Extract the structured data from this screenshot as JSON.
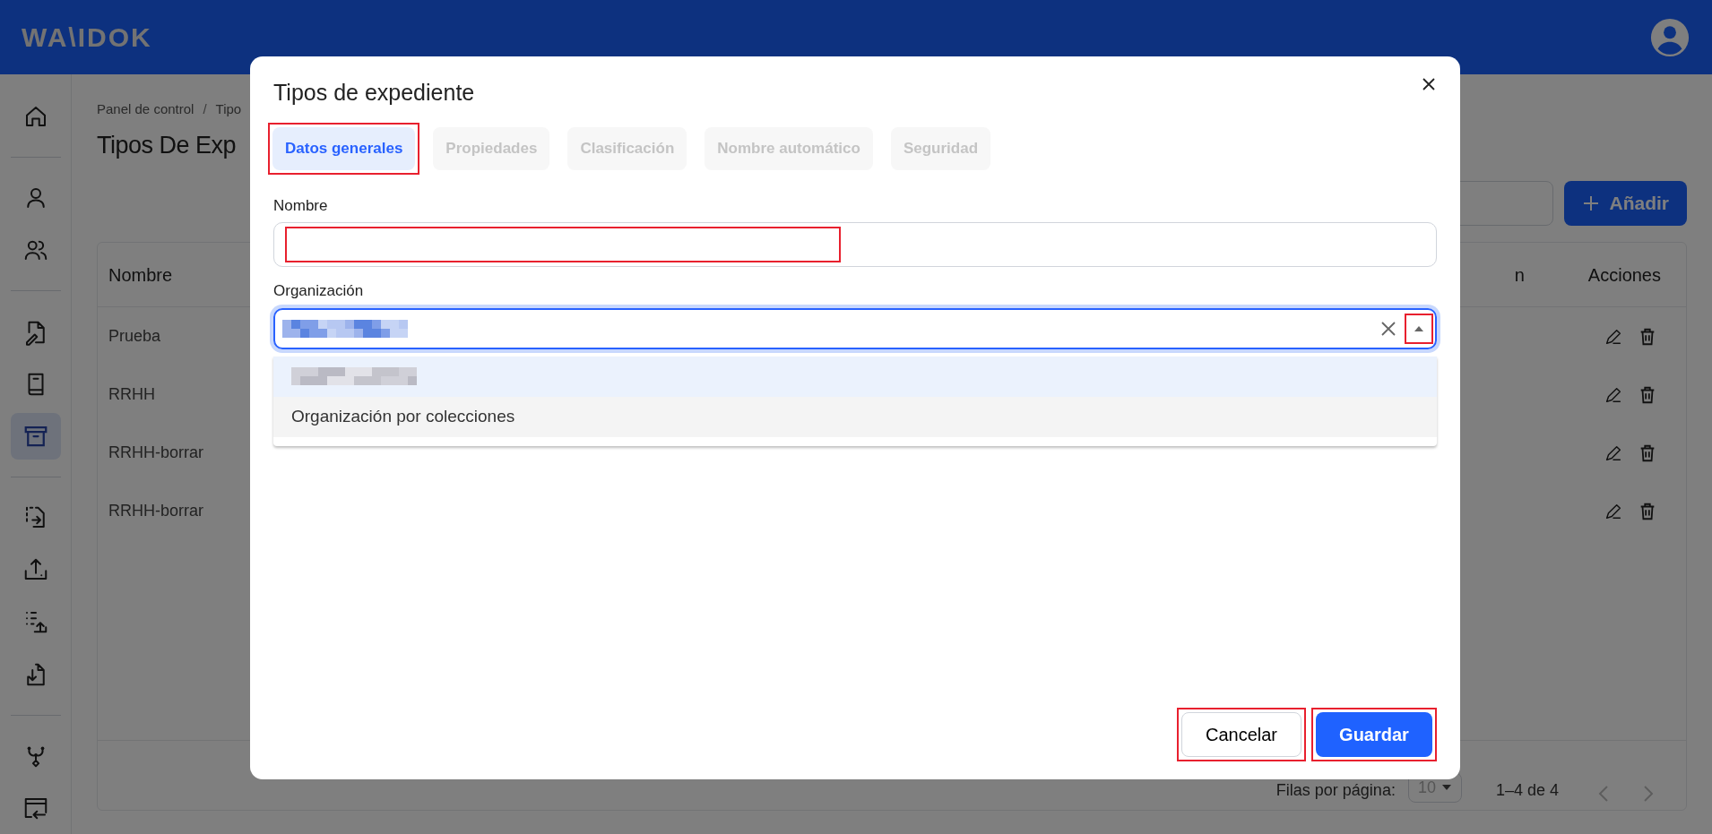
{
  "header": {
    "logo": "WA\\IDOK"
  },
  "sidebar": {
    "groups": [
      {
        "items": [
          {
            "selected": false
          }
        ]
      },
      {
        "items": [
          {
            "selected": false
          },
          {
            "selected": false
          }
        ]
      },
      {
        "items": [
          {
            "selected": false
          },
          {
            "selected": false
          },
          {
            "selected": true
          }
        ]
      },
      {
        "items": [
          {
            "selected": false
          },
          {
            "selected": false
          },
          {
            "selected": false
          },
          {
            "selected": false
          }
        ]
      },
      {
        "items": [
          {
            "selected": false
          },
          {
            "selected": false
          }
        ]
      }
    ]
  },
  "breadcrumb": [
    "Panel de control",
    "Tipo"
  ],
  "breadcrumb_separator": "/",
  "page_title": "Tipos De Exp",
  "add_button": {
    "label": "Añadir"
  },
  "table": {
    "columns": [
      "Nombre",
      "n",
      "Acciones"
    ],
    "rows": [
      {
        "name": "Prueba"
      },
      {
        "name": "RRHH"
      },
      {
        "name": "RRHH-borrar"
      },
      {
        "name": "RRHH-borrar"
      }
    ],
    "footer": {
      "rows_per_page_label": "Filas por página:",
      "rows_per_page": "10",
      "range": "1–4 de 4"
    }
  },
  "dialog": {
    "title": "Tipos de expediente",
    "tabs": [
      {
        "label": "Datos generales",
        "selected": true,
        "highlighted": true
      },
      {
        "label": "Propiedades",
        "selected": false,
        "highlighted": false
      },
      {
        "label": "Clasificación",
        "selected": false,
        "highlighted": false
      },
      {
        "label": "Nombre automático",
        "selected": false,
        "highlighted": false
      },
      {
        "label": "Seguridad",
        "selected": false,
        "highlighted": false
      }
    ],
    "name_field": {
      "label": "Nombre",
      "highlighted": true
    },
    "organization_field": {
      "label": "Organización",
      "redacted": true,
      "expanded": true,
      "toggle_highlighted": true,
      "options": [
        {
          "redacted": true,
          "selected": true,
          "hovered": false
        },
        {
          "label": "Organización por colecciones",
          "selected": false,
          "hovered": true
        }
      ]
    },
    "buttons": [
      {
        "label": "Cancelar",
        "kind": "secondary",
        "highlighted": true
      },
      {
        "label": "Guardar",
        "kind": "primary",
        "highlighted": true
      }
    ]
  }
}
